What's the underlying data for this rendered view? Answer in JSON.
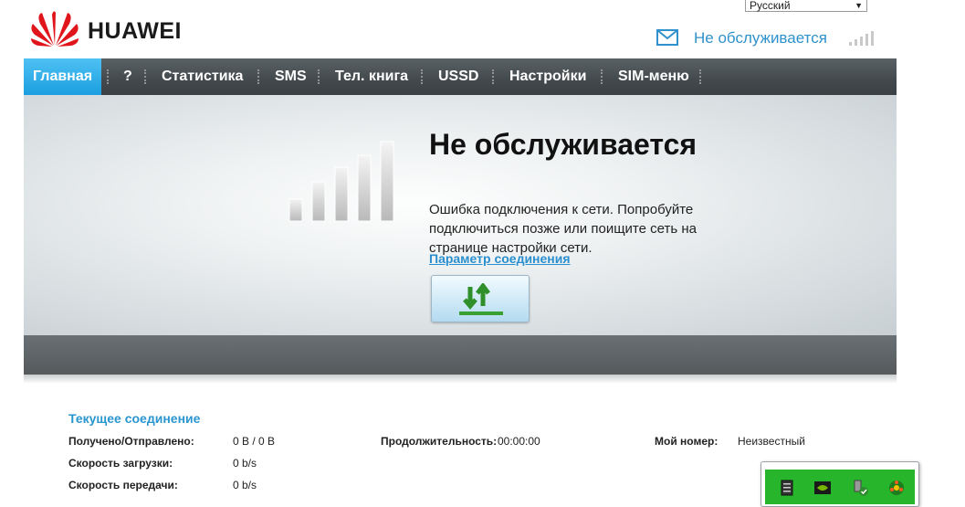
{
  "header": {
    "brand": "HUAWEI",
    "language": "Русский",
    "status": "Не обслуживается"
  },
  "nav": {
    "items": [
      {
        "label": "Главная"
      },
      {
        "label": "?"
      },
      {
        "label": "Статистика"
      },
      {
        "label": "SMS"
      },
      {
        "label": "Тел. книга"
      },
      {
        "label": "USSD"
      },
      {
        "label": "Настройки"
      },
      {
        "label": "SIM-меню"
      }
    ]
  },
  "hero": {
    "title": "Не обслуживается",
    "description": "Ошибка подключения к сети. Попробуйте подключиться позже или поищите сеть на странице настройки сети.",
    "link": "Параметр соединения"
  },
  "connection": {
    "title": "Текущее соединение",
    "received_sent_label": "Получено/Отправлено:",
    "received_sent_value": "0 B /  0 B",
    "download_label": "Скорость загрузки:",
    "download_value": "0 b/s",
    "upload_label": "Скорость передачи:",
    "upload_value": "0 b/s",
    "duration_label": "Продолжительность:",
    "duration_value": "00:00:00",
    "my_number_label": "Мой номер:",
    "my_number_value": "Неизвестный"
  },
  "colors": {
    "accent": "#2f92cc",
    "nav_bg": "#43494d",
    "nav_active": "#1b9ee0",
    "tray_green": "#27b52c"
  },
  "icons": [
    "huawei-logo",
    "mail-icon",
    "signal-icon",
    "signal-bars-icon",
    "connect-arrows-icon"
  ]
}
